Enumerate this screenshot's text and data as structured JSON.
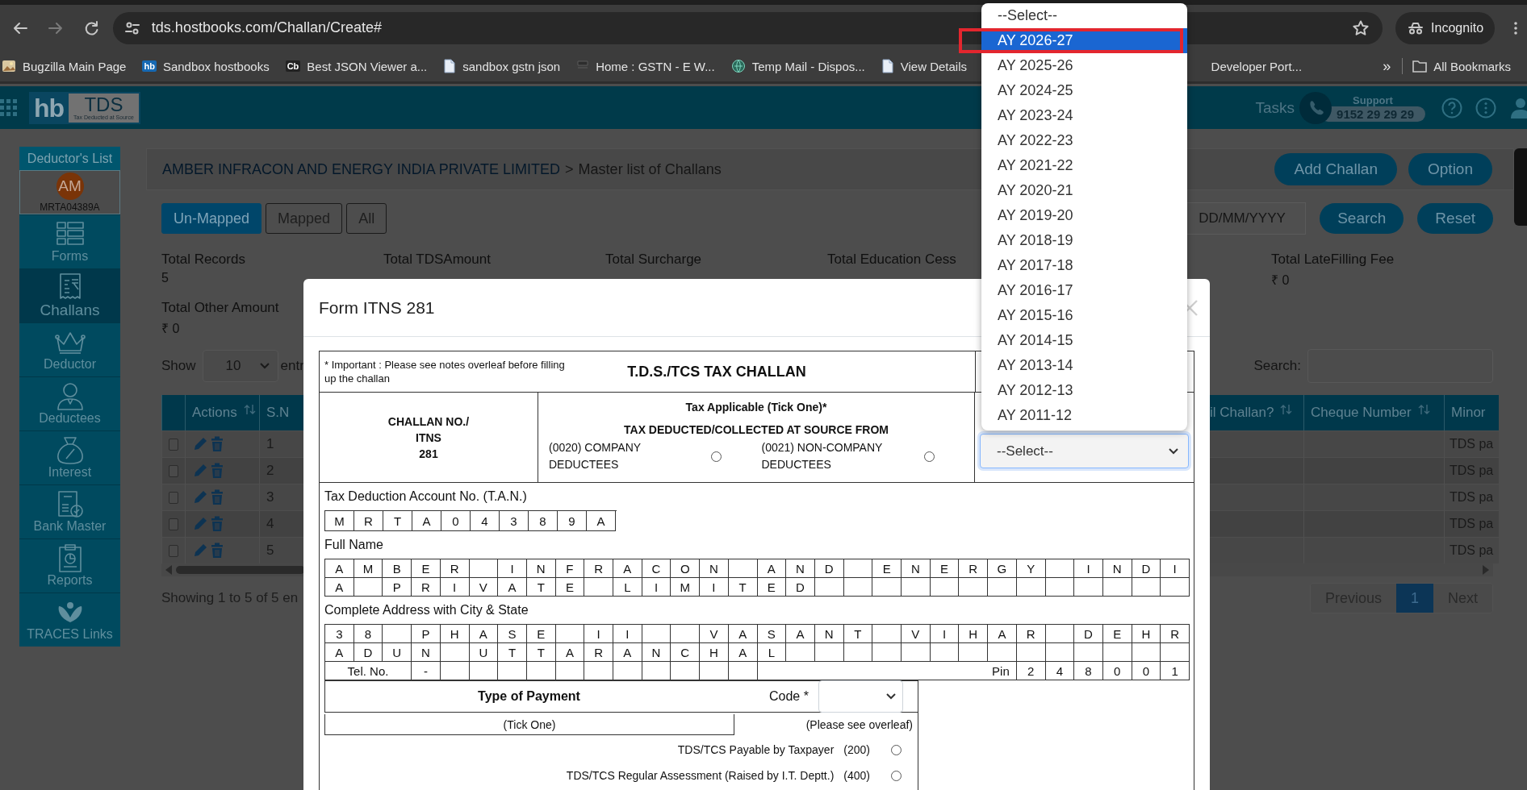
{
  "browser": {
    "url": "tds.hostbooks.com/Challan/Create#",
    "profile": "Incognito",
    "bookmarks": [
      {
        "label": "Bugzilla Main Page",
        "kind": "image"
      },
      {
        "label": "Sandbox hostbooks",
        "kind": "badge",
        "badge": "hb"
      },
      {
        "label": "Best JSON Viewer a...",
        "kind": "badge",
        "badge": "Cb"
      },
      {
        "label": "sandbox gstn json",
        "kind": "doc"
      },
      {
        "label": "Home : GSTN - E W...",
        "kind": "flag"
      },
      {
        "label": "Temp Mail - Dispos...",
        "kind": "globe"
      },
      {
        "label": "View Details",
        "kind": "doc"
      },
      {
        "label": "Developer Port...",
        "kind": "plain"
      }
    ],
    "more": "»",
    "all_bookmarks": "All Bookmarks"
  },
  "header": {
    "logo_mark": "hb",
    "logo_name": "TDS",
    "logo_tagline": "Tax Deducted at Source",
    "tasks": "Tasks",
    "support_label": "Support",
    "support_phone": "9152 29 29 29"
  },
  "sidebar": {
    "title": "Deductor's List",
    "avatar": "AM",
    "deductor_id": "MRTA04389A",
    "items": [
      {
        "label": "Forms",
        "kind": "forms",
        "selected": false
      },
      {
        "label": "Challans",
        "kind": "receipt",
        "selected": true
      },
      {
        "label": "Deductor",
        "kind": "crown",
        "selected": false
      },
      {
        "label": "Deductees",
        "kind": "person",
        "selected": false
      },
      {
        "label": "Interest",
        "kind": "bag",
        "selected": false
      },
      {
        "label": "Bank Master",
        "kind": "ledger",
        "selected": false
      },
      {
        "label": "Reports",
        "kind": "clipboard",
        "selected": false
      },
      {
        "label": "TRACES Links",
        "kind": "lotus",
        "selected": false
      }
    ]
  },
  "page": {
    "company": "AMBER INFRACON AND ENERGY INDIA PRIVATE LIMITED",
    "separator": ">",
    "title": "Master list of Challans",
    "actions": [
      "Add Challan",
      "Option"
    ],
    "filters": [
      {
        "label": "Un-Mapped",
        "selected": true
      },
      {
        "label": "Mapped",
        "selected": false
      },
      {
        "label": "All",
        "selected": false
      }
    ],
    "date_placeholder": "DD/MM/YYYY",
    "search_button": "Search",
    "reset_button": "Reset",
    "totals_left": [
      {
        "label": "Total Records",
        "value": "5"
      },
      {
        "label": "Total TDSAmount"
      },
      {
        "label": "Total Surcharge"
      },
      {
        "label": "Total Education Cess"
      }
    ],
    "totals_right": [
      {
        "label": "Total LateFilling Fee",
        "value": "₹ 0"
      }
    ],
    "totals_second": [
      {
        "label": "Total Other Amount",
        "value": "₹ 0"
      }
    ],
    "show_label": "Show",
    "page_size": "10",
    "entries_label": "entr",
    "search_label": "Search:",
    "table": {
      "columns": [
        "Actions",
        "S.N",
        "il Challan?",
        "Cheque Number",
        "Minor"
      ],
      "rows": [
        {
          "checked": false,
          "sn": "1",
          "minor": "TDS pa"
        },
        {
          "checked": false,
          "sn": "2",
          "minor": "TDS pa"
        },
        {
          "checked": false,
          "sn": "3",
          "minor": "TDS pa"
        },
        {
          "checked": false,
          "sn": "4",
          "minor": "TDS pa"
        },
        {
          "checked": false,
          "sn": "5",
          "minor": "TDS pa"
        }
      ]
    },
    "showing": "Showing 1 to 5 of 5 en",
    "pagination": [
      {
        "label": "Previous",
        "selected": false
      },
      {
        "label": "1",
        "selected": true
      },
      {
        "label": "Next",
        "selected": false
      }
    ]
  },
  "modal": {
    "title": "Form ITNS 281",
    "challan": {
      "note": "* Important : Please see notes overleaf before filling up the challan",
      "heading": "T.D.S./TCS TAX CHALLAN",
      "number_lines": [
        "CHALLAN NO./",
        "ITNS",
        "281"
      ],
      "tax_title": "Tax Applicable (Tick One)*",
      "tax_subtitle": "TAX DEDUCTED/COLLECTED AT SOURCE FROM",
      "tax_options": [
        {
          "label": "(0020) COMPANY DEDUCTEES",
          "selected": false
        },
        {
          "label": "(0021) NON-COMPANY DEDUCTEES",
          "selected": false
        }
      ],
      "assessment_year": {
        "value": "--Select--",
        "expanded": true,
        "options": [
          {
            "label": "--Select--",
            "highlighted": false
          },
          {
            "label": "AY 2026-27",
            "highlighted": true
          },
          {
            "label": "AY 2025-26",
            "highlighted": false
          },
          {
            "label": "AY 2024-25",
            "highlighted": false
          },
          {
            "label": "AY 2023-24",
            "highlighted": false
          },
          {
            "label": "AY 2022-23",
            "highlighted": false
          },
          {
            "label": "AY 2021-22",
            "highlighted": false
          },
          {
            "label": "AY 2020-21",
            "highlighted": false
          },
          {
            "label": "AY 2019-20",
            "highlighted": false
          },
          {
            "label": "AY 2018-19",
            "highlighted": false
          },
          {
            "label": "AY 2017-18",
            "highlighted": false
          },
          {
            "label": "AY 2016-17",
            "highlighted": false
          },
          {
            "label": "AY 2015-16",
            "highlighted": false
          },
          {
            "label": "AY 2014-15",
            "highlighted": false
          },
          {
            "label": "AY 2013-14",
            "highlighted": false
          },
          {
            "label": "AY 2012-13",
            "highlighted": false
          },
          {
            "label": "AY 2011-12",
            "highlighted": false
          }
        ]
      },
      "tan_label": "Tax Deduction Account No. (T.A.N.)",
      "tan": [
        "M",
        "R",
        "T",
        "A",
        "0",
        "4",
        "3",
        "8",
        "9",
        "A"
      ],
      "name_label": "Full Name",
      "name_rows": [
        [
          "A",
          "M",
          "B",
          "E",
          "R",
          null,
          "I",
          "N",
          "F",
          "R",
          "A",
          "C",
          "O",
          "N",
          null,
          "A",
          "N",
          "D",
          null,
          "E",
          "N",
          "E",
          "R",
          "G",
          "Y",
          null,
          "I",
          "N",
          "D",
          "I"
        ],
        [
          "A",
          null,
          "P",
          "R",
          "I",
          "V",
          "A",
          "T",
          "E",
          null,
          "L",
          "I",
          "M",
          "I",
          "T",
          "E",
          "D"
        ]
      ],
      "address_label": "Complete Address with City & State",
      "address_rows": [
        [
          "3",
          "8",
          null,
          "P",
          "H",
          "A",
          "S",
          "E",
          null,
          "I",
          "I",
          null,
          null,
          "V",
          "A",
          "S",
          "A",
          "N",
          "T",
          null,
          "V",
          "I",
          "H",
          "A",
          "R",
          null,
          "D",
          "E",
          "H",
          "R"
        ],
        [
          "A",
          "D",
          "U",
          "N",
          null,
          "U",
          "T",
          "T",
          "A",
          "R",
          "A",
          "N",
          "C",
          "H",
          "A",
          "L"
        ]
      ],
      "tel_label": "Tel. No.",
      "tel_value": "-",
      "pin_label": "Pin",
      "pin": [
        "2",
        "4",
        "8",
        "0",
        "0",
        "1"
      ],
      "payment_title": "Type of Payment",
      "code_label": "Code *",
      "tick_note": "(Tick One)",
      "overleaf_note": "(Please see overleaf)",
      "payment_types": [
        {
          "label": "TDS/TCS Payable by Taxpayer",
          "code": "(200)",
          "selected": false
        },
        {
          "label": "TDS/TCS Regular Assessment (Raised by I.T. Deptt.)",
          "code": "(400)",
          "selected": false
        }
      ]
    }
  }
}
